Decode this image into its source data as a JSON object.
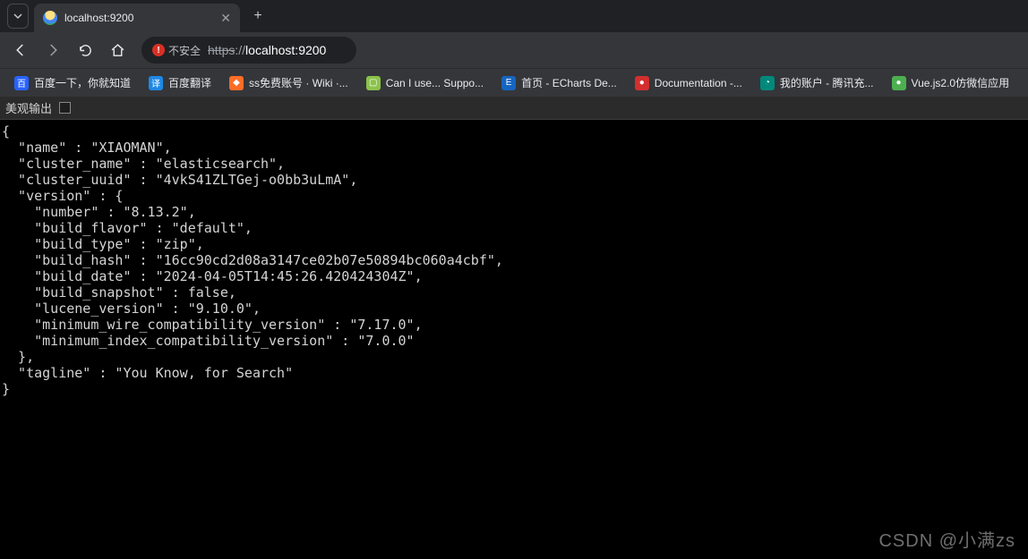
{
  "tab": {
    "title": "localhost:9200"
  },
  "toolbar": {
    "not_secure_label": "不安全",
    "url_scheme": "https",
    "url_slashes": "://",
    "url_host": "localhost:9200"
  },
  "bookmarks": [
    {
      "label": "百度一下，你就知道",
      "icon_bg": "#2962ff",
      "icon_txt": "百"
    },
    {
      "label": "百度翻译",
      "icon_bg": "#1e88e5",
      "icon_txt": "译"
    },
    {
      "label": "ss免费账号 · Wiki ·...",
      "icon_bg": "#fc6d26",
      "icon_txt": "◆"
    },
    {
      "label": "Can I use... Suppo...",
      "icon_bg": "#8bc34a",
      "icon_txt": "▢"
    },
    {
      "label": "首页 - ECharts De...",
      "icon_bg": "#1565c0",
      "icon_txt": "E"
    },
    {
      "label": "Documentation -...",
      "icon_bg": "#d32f2f",
      "icon_txt": "●"
    },
    {
      "label": "我的账户 - 腾讯充...",
      "icon_bg": "#00897b",
      "icon_txt": "◔"
    },
    {
      "label": "Vue.js2.0仿微信应用",
      "icon_bg": "#4caf50",
      "icon_txt": "●"
    }
  ],
  "pretty_bar": {
    "label": "美观输出"
  },
  "json_body": {
    "name": "XIAOMAN",
    "cluster_name": "elasticsearch",
    "cluster_uuid": "4vkS41ZLTGej-o0bb3uLmA",
    "version": {
      "number": "8.13.2",
      "build_flavor": "default",
      "build_type": "zip",
      "build_hash": "16cc90cd2d08a3147ce02b07e50894bc060a4cbf",
      "build_date": "2024-04-05T14:45:26.420424304Z",
      "build_snapshot": false,
      "lucene_version": "9.10.0",
      "minimum_wire_compatibility_version": "7.17.0",
      "minimum_index_compatibility_version": "7.0.0"
    },
    "tagline": "You Know, for Search"
  },
  "watermark": "CSDN @小满zs"
}
